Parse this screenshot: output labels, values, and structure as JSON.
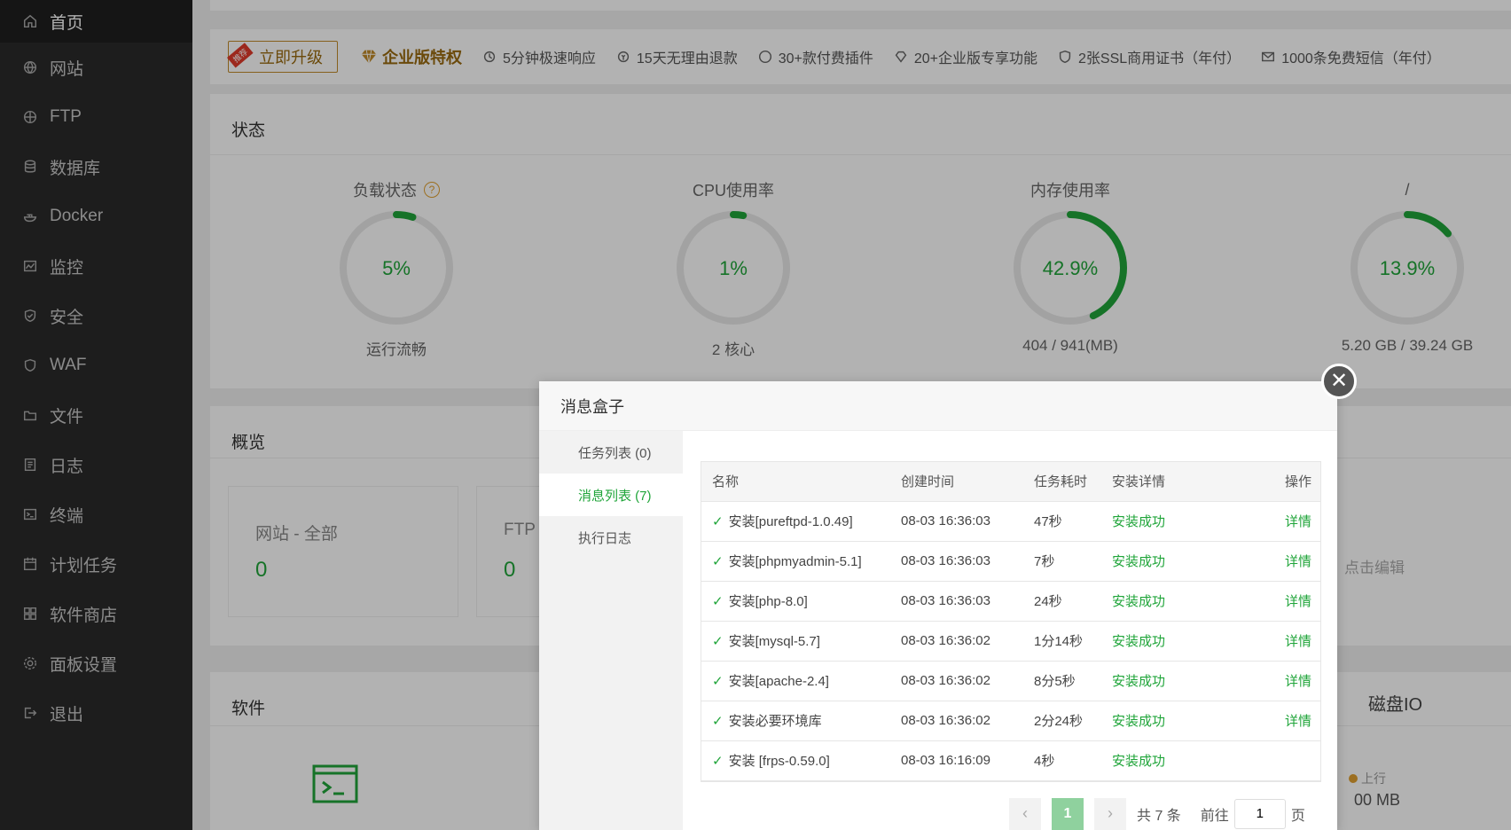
{
  "sidebar": {
    "items": [
      {
        "label": "首页",
        "icon": "home-icon"
      },
      {
        "label": "网站",
        "icon": "globe-icon"
      },
      {
        "label": "FTP",
        "icon": "globe-icon"
      },
      {
        "label": "数据库",
        "icon": "database-icon"
      },
      {
        "label": "Docker",
        "icon": "docker-icon"
      },
      {
        "label": "监控",
        "icon": "monitor-icon"
      },
      {
        "label": "安全",
        "icon": "shield-icon"
      },
      {
        "label": "WAF",
        "icon": "shield-icon"
      },
      {
        "label": "文件",
        "icon": "folder-icon"
      },
      {
        "label": "日志",
        "icon": "log-icon"
      },
      {
        "label": "终端",
        "icon": "terminal-icon"
      },
      {
        "label": "计划任务",
        "icon": "calendar-icon"
      },
      {
        "label": "软件商店",
        "icon": "grid-icon"
      },
      {
        "label": "面板设置",
        "icon": "gear-icon"
      },
      {
        "label": "退出",
        "icon": "logout-icon"
      }
    ]
  },
  "promo": {
    "upgrade_ribbon": "推荐",
    "upgrade_label": "立即升级",
    "enterprise_label": "企业版特权",
    "features": [
      "5分钟极速响应",
      "15天无理由退款",
      "30+款付费插件",
      "20+企业版专享功能",
      "2张SSL商用证书（年付）",
      "1000条免费短信（年付）"
    ]
  },
  "status": {
    "title": "状态",
    "gauges": [
      {
        "title": "负载状态",
        "value": "5%",
        "percent": 5,
        "sub": "运行流畅",
        "help": "?"
      },
      {
        "title": "CPU使用率",
        "value": "1%",
        "percent": 1,
        "sub": "2 核心"
      },
      {
        "title": "内存使用率",
        "value": "42.9%",
        "percent": 42.9,
        "sub": "404 / 941(MB)"
      },
      {
        "title": "/",
        "value": "13.9%",
        "percent": 13.9,
        "sub": "5.20 GB / 39.24 GB"
      }
    ]
  },
  "overview": {
    "title": "概览",
    "boxes": [
      {
        "label": "网站 - 全部",
        "value": "0"
      },
      {
        "label": "FTP",
        "value": "0"
      }
    ],
    "hint": "，点击编辑"
  },
  "software": {
    "title": "软件",
    "disk_io_title": "磁盘IO",
    "up_label": "上行",
    "mb_text": "00 MB"
  },
  "modal": {
    "title": "消息盒子",
    "close_glyph": "✕",
    "tabs": [
      "任务列表 (0)",
      "消息列表 (7)",
      "执行日志"
    ],
    "columns": [
      "名称",
      "创建时间",
      "任务耗时",
      "安装详情",
      "操作"
    ],
    "rows": [
      {
        "name": "安装[pureftpd-1.0.49]",
        "time": "08-03 16:36:03",
        "duration": "47秒",
        "status": "安装成功",
        "op": "详情"
      },
      {
        "name": "安装[phpmyadmin-5.1]",
        "time": "08-03 16:36:03",
        "duration": "7秒",
        "status": "安装成功",
        "op": "详情"
      },
      {
        "name": "安装[php-8.0]",
        "time": "08-03 16:36:03",
        "duration": "24秒",
        "status": "安装成功",
        "op": "详情"
      },
      {
        "name": "安装[mysql-5.7]",
        "time": "08-03 16:36:02",
        "duration": "1分14秒",
        "status": "安装成功",
        "op": "详情"
      },
      {
        "name": "安装[apache-2.4]",
        "time": "08-03 16:36:02",
        "duration": "8分5秒",
        "status": "安装成功",
        "op": "详情"
      },
      {
        "name": "安装必要环境库",
        "time": "08-03 16:36:02",
        "duration": "2分24秒",
        "status": "安装成功",
        "op": "详情"
      },
      {
        "name": "安装 [frps-0.59.0]",
        "time": "08-03 16:16:09",
        "duration": "4秒",
        "status": "安装成功",
        "op": ""
      }
    ],
    "pager": {
      "prev": "‹",
      "current": "1",
      "next": "›",
      "total": "共 7 条",
      "goto": "前往",
      "page_value": "1",
      "page_unit": "页"
    }
  },
  "colors": {
    "accent": "#20a53a",
    "sidebar_bg": "#2a2a2a",
    "gold": "#9a6a10"
  }
}
